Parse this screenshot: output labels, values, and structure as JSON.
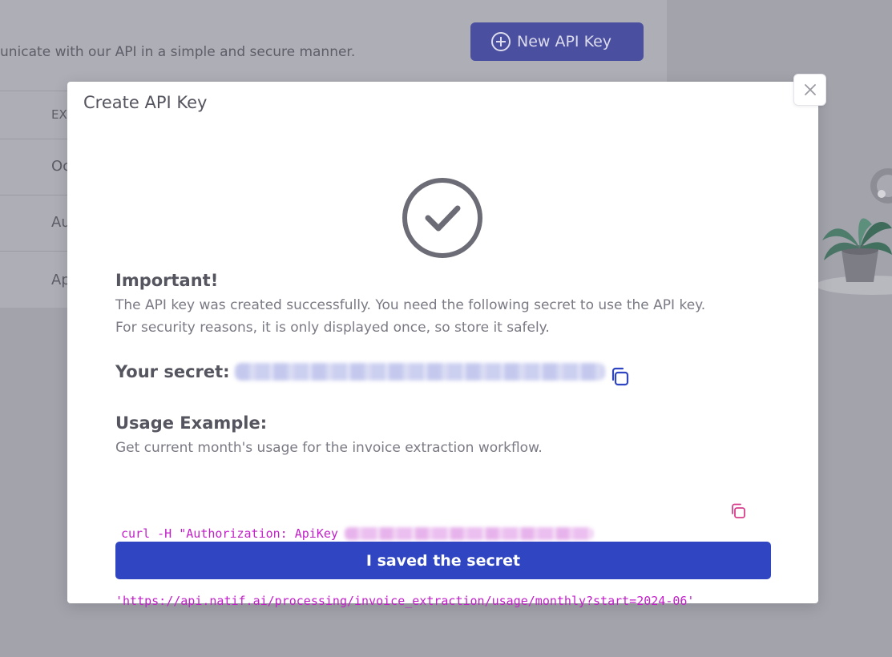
{
  "background": {
    "description": "unicate with our API in a simple and secure manner.",
    "new_key_button": "New API Key",
    "rows": [
      "EX",
      "Oc",
      "Au",
      "Ap"
    ]
  },
  "modal": {
    "title": "Create API Key",
    "important_heading": "Important!",
    "important_line1": "The API key was created successfully. You need the following secret to use the API key.",
    "important_line2": "For security reasons, it is only displayed once, so store it safely.",
    "secret_label": "Your secret:",
    "usage_heading": "Usage Example:",
    "usage_desc": "Get current month's usage for the invoice extraction workflow.",
    "code_line1": "curl -H \"Authorization: ApiKey",
    "code_line2": "'https://api.natif.ai/processing/invoice_extraction/usage/monthly?start=2024-06'",
    "confirm_button": "I saved the secret"
  },
  "colors": {
    "primary": "#2f45c2",
    "code": "#c21fc9",
    "overlay": "#a3a3ac"
  },
  "icons": {
    "close": "close-icon",
    "success": "check-circle-icon",
    "copy": "copy-icon",
    "add": "plus-circle-icon"
  }
}
